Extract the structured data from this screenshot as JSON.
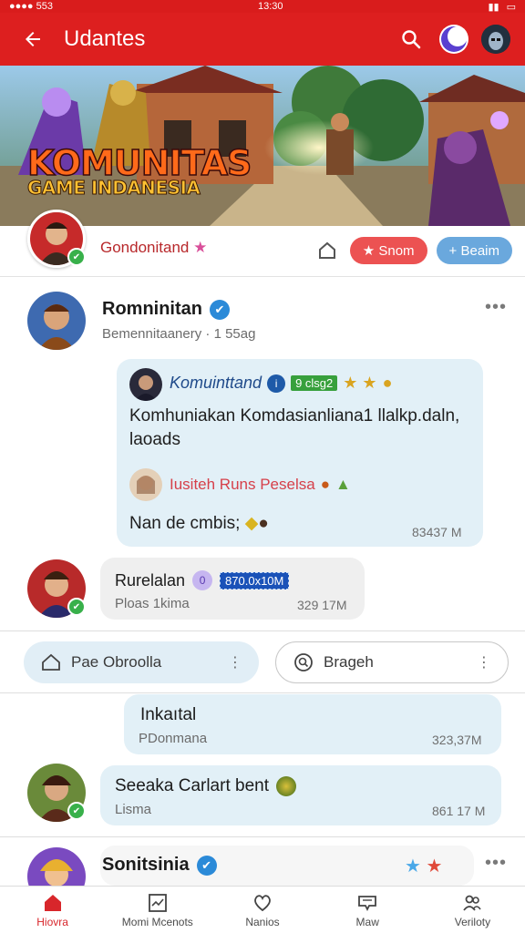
{
  "status_bar": {
    "carrier": "●●●● 553",
    "time": "13:30"
  },
  "app_bar": {
    "title": "Udantes"
  },
  "banner": {
    "title": "KOMUNITAS",
    "subtitle": "GAME INDANESIA"
  },
  "community": {
    "name": "Gondonitand",
    "join_label": "★ Snom",
    "share_label": "+ Beaim"
  },
  "post1": {
    "author": "Romninitan",
    "meta": "Bemennitaanery · 1 55ag",
    "quote": {
      "author": "Komuinttand",
      "badge": "9 clsg2",
      "text": "Komhuniakan Komdasianliana1 llalkp.daln, laoads",
      "reply_name": "Iusiteh Runs Peselsa",
      "reply_text": "Nan de cmbis;",
      "time": "83437 M"
    }
  },
  "reply1": {
    "author": "Rurelalan",
    "badge": "870.0x10M",
    "text": "Ploas 1kima",
    "time": "329 17M"
  },
  "chips": {
    "left": "Pae Obroolla",
    "right": "Brageh"
  },
  "msg_a": {
    "title": "Inkaıtal",
    "subtitle": "PDonmana",
    "time": "323,37M"
  },
  "msg_b": {
    "title": "Seeaka Carlart bent",
    "subtitle": "Lisma",
    "time": "861 17 M"
  },
  "post2": {
    "author": "Sonitsinia"
  },
  "bottom_nav": {
    "items": [
      {
        "label": "Hiovra"
      },
      {
        "label": "Momi Mcenots"
      },
      {
        "label": "Nanios"
      },
      {
        "label": "Maw"
      },
      {
        "label": "Veriloty"
      }
    ]
  },
  "colors": {
    "brand_red": "#dd1f1f",
    "bubble_blue": "#e2f0f7",
    "verified_blue": "#2b8ad8"
  }
}
